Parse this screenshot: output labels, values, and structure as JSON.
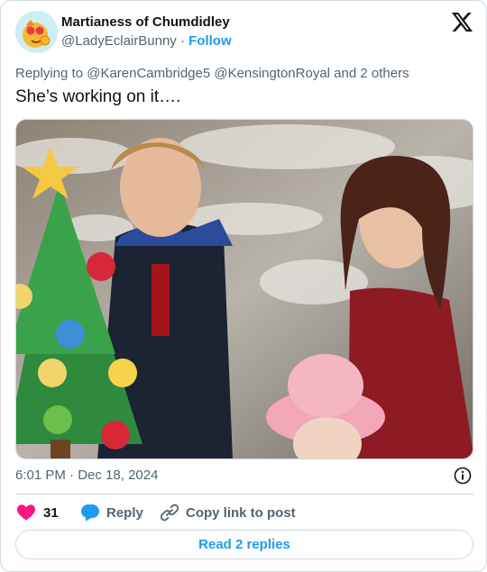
{
  "author": {
    "display_name": "Martianess of Chumdidley",
    "handle": "@LadyEclairBunny",
    "separator": "·",
    "follow_label": "Follow"
  },
  "reply_context": {
    "prefix": "Replying to",
    "mentions": [
      "@KarenCambridge5",
      "@KensingtonRoyal"
    ],
    "suffix": "and 2 others"
  },
  "tweet": {
    "text": "She’s working on it…."
  },
  "timestamp": {
    "time": "6:01 PM",
    "separator": "·",
    "date": "Dec 18, 2024"
  },
  "actions": {
    "likes_count": "31",
    "reply_label": "Reply",
    "copy_link_label": "Copy link to post"
  },
  "read_replies_label": "Read 2 replies",
  "icons": {
    "brand": "x-logo-icon",
    "info": "info-icon",
    "like": "heart-icon",
    "reply": "speech-bubble-icon",
    "copy": "link-icon"
  },
  "colors": {
    "accent": "#1d9bf0",
    "like": "#f91880",
    "muted_text": "#536471",
    "border": "#cfd9de"
  }
}
